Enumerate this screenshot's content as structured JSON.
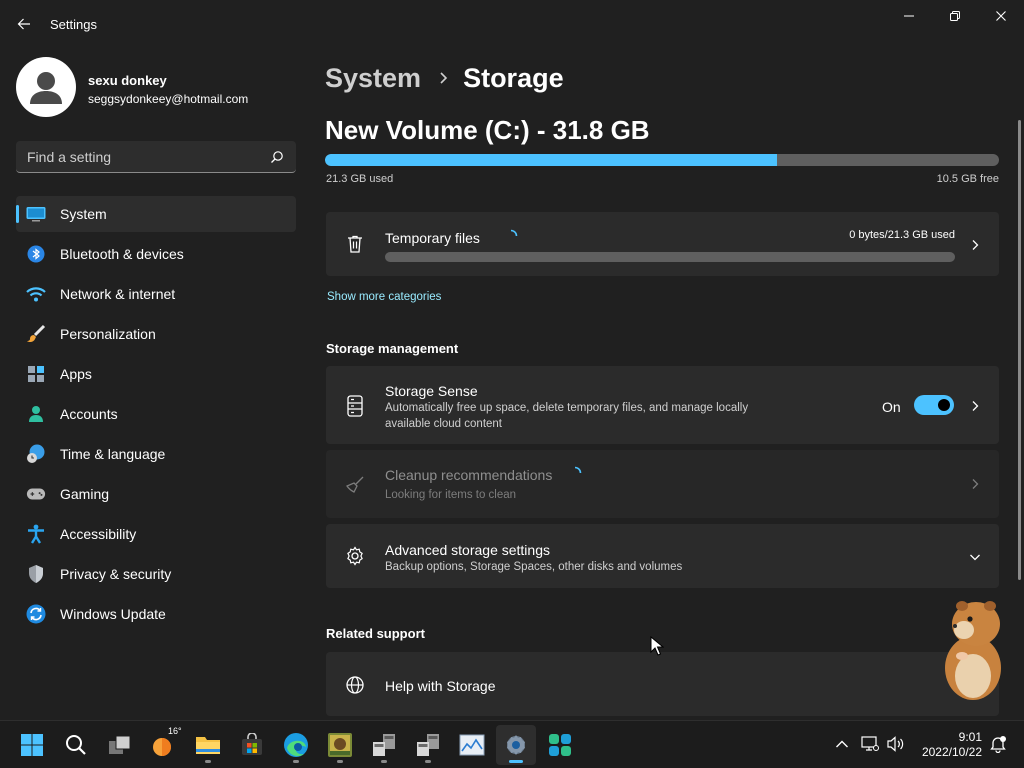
{
  "window": {
    "app_title": "Settings"
  },
  "profile": {
    "name": "sexu donkey",
    "email": "seggsydonkeey@hotmail.com"
  },
  "search": {
    "placeholder": "Find a setting"
  },
  "sidebar": {
    "items": [
      {
        "label": "System",
        "icon": "system-icon",
        "selected": true
      },
      {
        "label": "Bluetooth & devices",
        "icon": "bluetooth-icon"
      },
      {
        "label": "Network & internet",
        "icon": "wifi-icon"
      },
      {
        "label": "Personalization",
        "icon": "paintbrush-icon"
      },
      {
        "label": "Apps",
        "icon": "apps-icon"
      },
      {
        "label": "Accounts",
        "icon": "account-icon"
      },
      {
        "label": "Time & language",
        "icon": "globe-clock-icon"
      },
      {
        "label": "Gaming",
        "icon": "gamepad-icon"
      },
      {
        "label": "Accessibility",
        "icon": "accessibility-icon"
      },
      {
        "label": "Privacy & security",
        "icon": "shield-icon"
      },
      {
        "label": "Windows Update",
        "icon": "update-icon"
      }
    ]
  },
  "breadcrumb": {
    "parent": "System",
    "separator": "›",
    "current": "Storage"
  },
  "volume": {
    "title": "New Volume (C:) - 31.8 GB",
    "used_label": "21.3 GB used",
    "free_label": "10.5 GB free",
    "used_fraction": 0.67
  },
  "temp_files": {
    "title": "Temporary files",
    "usage": "0 bytes/21.3 GB used"
  },
  "show_more": "Show more categories",
  "storage_management": {
    "heading": "Storage management",
    "storage_sense": {
      "title": "Storage Sense",
      "description": "Automatically free up space, delete temporary files, and manage locally available cloud content",
      "toggle_label": "On",
      "toggle_on": true
    },
    "cleanup": {
      "title": "Cleanup recommendations",
      "description": "Looking for items to clean"
    },
    "advanced": {
      "title": "Advanced storage settings",
      "description": "Backup options, Storage Spaces, other disks and volumes"
    }
  },
  "related_support": {
    "heading": "Related support",
    "help": {
      "title": "Help with Storage"
    }
  },
  "taskbar": {
    "weather_temp": "16°",
    "time": "9:01",
    "date": "2022/10/22"
  },
  "colors": {
    "accent": "#4cc2ff",
    "link": "#99ebff",
    "background": "#202020",
    "card": "#2b2b2b"
  }
}
